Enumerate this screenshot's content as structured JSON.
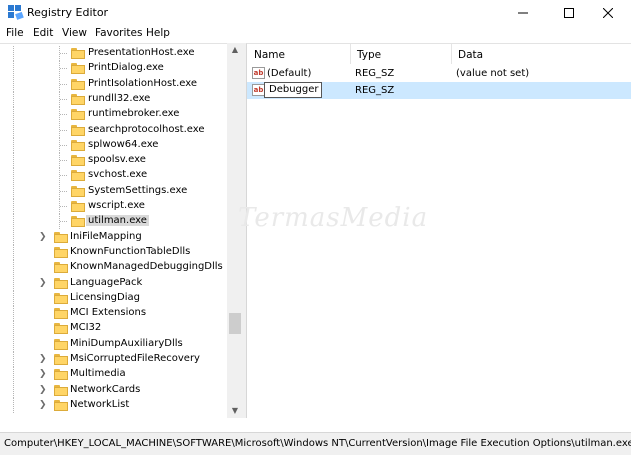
{
  "window": {
    "title": "Registry Editor",
    "minimize_glyph": "—",
    "maximize_glyph": "☐",
    "close_glyph": "✕"
  },
  "menu": [
    "File",
    "Edit",
    "View",
    "Favorites",
    "Help"
  ],
  "tree": {
    "child_items": [
      "PresentationHost.exe",
      "PrintDialog.exe",
      "PrintIsolationHost.exe",
      "rundll32.exe",
      "runtimebroker.exe",
      "searchprotocolhost.exe",
      "splwow64.exe",
      "spoolsv.exe",
      "svchost.exe",
      "SystemSettings.exe",
      "wscript.exe",
      "utilman.exe"
    ],
    "selected_item": "utilman.exe",
    "sibling_items": [
      {
        "label": "IniFileMapping",
        "expandable": true
      },
      {
        "label": "KnownFunctionTableDlls",
        "expandable": false
      },
      {
        "label": "KnownManagedDebuggingDlls",
        "expandable": false
      },
      {
        "label": "LanguagePack",
        "expandable": true
      },
      {
        "label": "LicensingDiag",
        "expandable": false
      },
      {
        "label": "MCI Extensions",
        "expandable": false
      },
      {
        "label": "MCI32",
        "expandable": false
      },
      {
        "label": "MiniDumpAuxiliaryDlls",
        "expandable": false
      },
      {
        "label": "MsiCorruptedFileRecovery",
        "expandable": true
      },
      {
        "label": "Multimedia",
        "expandable": true
      },
      {
        "label": "NetworkCards",
        "expandable": true
      },
      {
        "label": "NetworkList",
        "expandable": true
      }
    ]
  },
  "values": {
    "columns": [
      "Name",
      "Type",
      "Data"
    ],
    "rows": [
      {
        "name": "(Default)",
        "type": "REG_SZ",
        "data": "(value not set)",
        "icon": "string-value-icon"
      },
      {
        "name": "Debugger",
        "type": "REG_SZ",
        "data": "",
        "icon": "string-value-icon",
        "editing": true
      }
    ],
    "icon_text": "ab"
  },
  "watermark": "TermasMedia",
  "status": {
    "path": "Computer\\HKEY_LOCAL_MACHINE\\SOFTWARE\\Microsoft\\Windows NT\\CurrentVersion\\Image File Execution Options\\utilman.exe"
  },
  "colors": {
    "selection": "#cce8ff",
    "folder": "#ffd566",
    "tree_selected": "#d9d9d9"
  }
}
